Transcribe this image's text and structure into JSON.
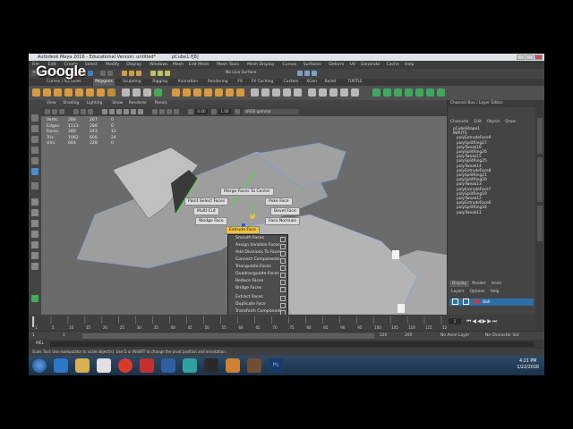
{
  "window": {
    "title": "Autodesk Maya 2016 - Educational Version: untitled*",
    "object": "pCube1.f[8]"
  },
  "logo": {
    "text": "Google"
  },
  "menubar": {
    "items": [
      "File",
      "Edit",
      "Create",
      "Select",
      "Modify",
      "Display",
      "Windows",
      "Mesh",
      "Edit Mesh",
      "Mesh Tools",
      "Mesh Display",
      "Curves",
      "Surfaces",
      "Deform",
      "UV",
      "Generate",
      "Cache",
      "Help"
    ]
  },
  "statusline": {
    "mode": "Modeling",
    "surface": "No Live Surface"
  },
  "shelf": {
    "tabs": [
      "Curves / Surfaces",
      "Polygons",
      "Sculpting",
      "Rigging",
      "Animation",
      "Rendering",
      "FX",
      "FX Caching",
      "Custom",
      "XGen",
      "Bullet",
      "TURTLE"
    ],
    "active_tab": "Polygons"
  },
  "viewport": {
    "menu": [
      "View",
      "Shading",
      "Lighting",
      "Show",
      "Renderer",
      "Panels"
    ],
    "exposure": "0.00",
    "gamma": "1.00",
    "colorspace": "sRGB gamma",
    "hud": [
      {
        "label": "Verts:",
        "a": "288",
        "b": "267",
        "c": "0"
      },
      {
        "label": "Edges:",
        "a": "1113",
        "b": "288",
        "c": "0"
      },
      {
        "label": "Faces:",
        "a": "280",
        "b": "243",
        "c": "12"
      },
      {
        "label": "Tris:",
        "a": "1062",
        "b": "608",
        "c": "24"
      },
      {
        "label": "UVs:",
        "a": "664",
        "b": "228",
        "c": "0"
      }
    ],
    "marking_menu": {
      "north": "Merge Faces To Center",
      "northwest": "Paint Select Faces",
      "northeast": "Poke Face",
      "west": "Multi-Cut",
      "east": "Bevel Face",
      "southwest": "Wedge Face",
      "southeast": "Face Normals",
      "south": "Extrude Face"
    },
    "marking_list": [
      "Smooth Faces",
      "Assign Invisible Faces",
      "Add Divisions To Faces",
      "Connect Components",
      "Triangulate Faces",
      "Quadrangulate Faces",
      "Reduce Faces",
      "Bridge Faces",
      "Extract Faces",
      "Duplicate Face",
      "Transform Component",
      "Connect Tool",
      "Target Weld Tool",
      "Mapping",
      "Polygon Display"
    ]
  },
  "channel_box": {
    "header": "Channel Box / Layer Editor",
    "menu": [
      "Channels",
      "Edit",
      "Object",
      "Show"
    ],
    "items": [
      "pCubeShape1",
      "INPUTS",
      "polyExtrudeFace9",
      "polySplitRing27",
      "polyTweak16",
      "polySplitRing26",
      "polyTweak15",
      "polySplitRing25",
      "polyTweak14",
      "polyExtrudeFace8",
      "polySplitRing21",
      "polySplitRing20",
      "polyTweak13",
      "polyExtrudeFace7",
      "polySplitRing19",
      "polyTweak12",
      "polyExtrudeFace6",
      "polySplitRing18",
      "polyTweak11"
    ]
  },
  "layers": {
    "tabs": [
      "Display",
      "Render",
      "Anim"
    ],
    "menu": [
      "Layers",
      "Options",
      "Help"
    ],
    "layer_name": "Ball"
  },
  "timeline": {
    "ticks": [
      "1",
      "5",
      "10",
      "15",
      "20",
      "25",
      "30",
      "35",
      "40",
      "45",
      "50",
      "55",
      "60",
      "65",
      "70",
      "75",
      "80",
      "85",
      "90",
      "95",
      "100",
      "105",
      "110",
      "115",
      "120"
    ],
    "current": "1"
  },
  "range": {
    "start": "1",
    "inner_start": "1",
    "inner_end": "120",
    "end": "200",
    "anim_layer": "No Anim Layer",
    "char_set": "No Character Set"
  },
  "mel": {
    "label": "MEL"
  },
  "help_line": "Scale Tool: Use manipulator to scale object(s). Use D or INSERT to change the pivot position and orientation.",
  "taskbar": {
    "time": "4:21 PM",
    "date": "1/22/2018"
  }
}
